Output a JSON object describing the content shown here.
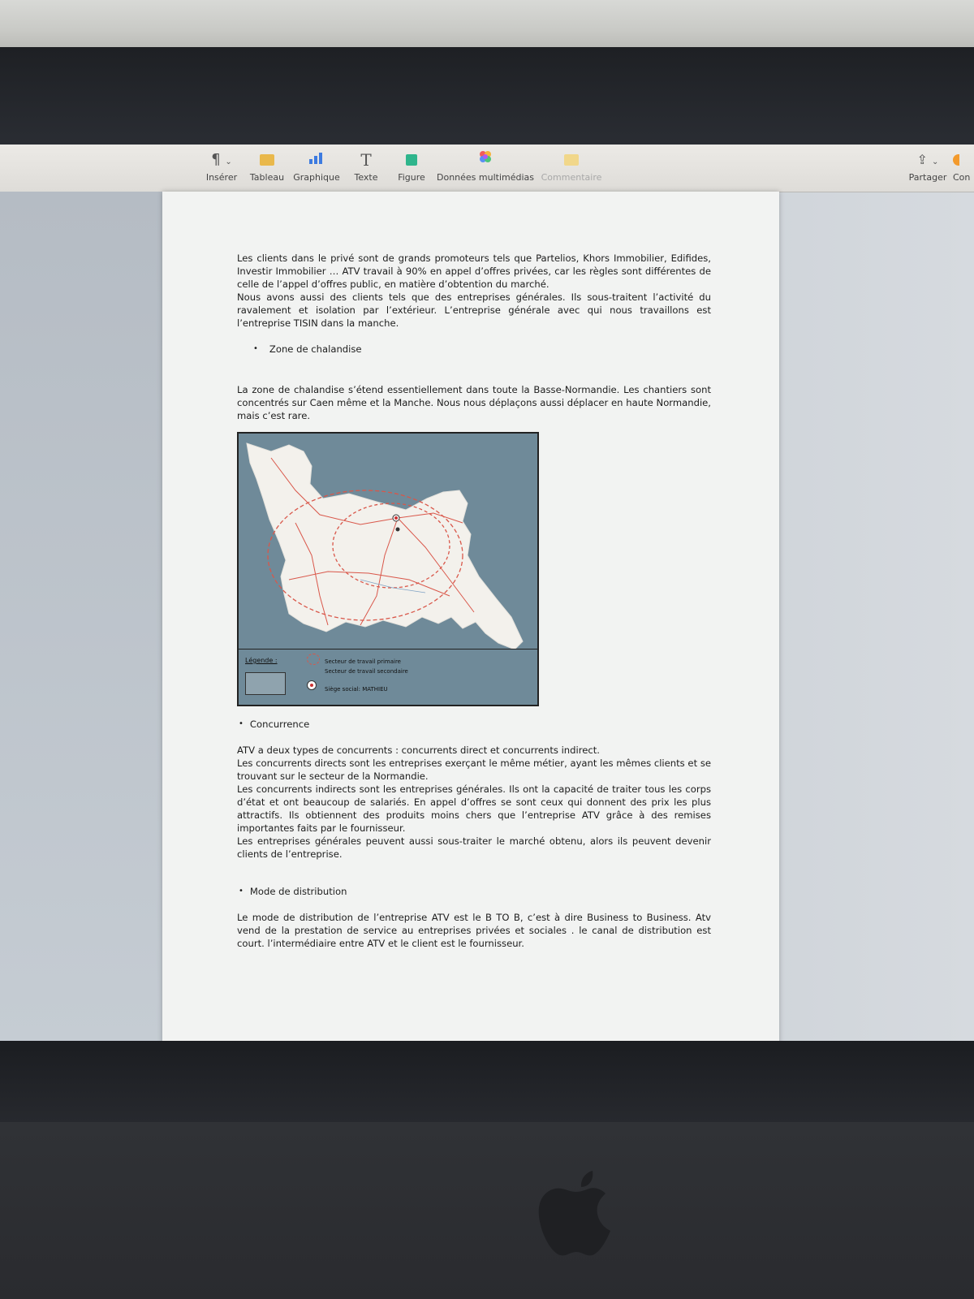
{
  "toolbar": {
    "items": [
      {
        "label": "Insérer",
        "icon": "paragraph-icon"
      },
      {
        "label": "Tableau",
        "icon": "table-icon"
      },
      {
        "label": "Graphique",
        "icon": "chart-icon"
      },
      {
        "label": "Texte",
        "icon": "text-icon"
      },
      {
        "label": "Figure",
        "icon": "shape-icon"
      },
      {
        "label": "Données multimédias",
        "icon": "media-icon"
      },
      {
        "label": "Commentaire",
        "icon": "comment-icon"
      }
    ],
    "share_label": "Partager",
    "cut_label": "Con"
  },
  "doc": {
    "para1": "Les clients dans le privé sont de grands promoteurs tels que Partelios, Khors Immobilier, Edifides, Investir Immobilier … ATV travail à 90% en appel d’offres privées, car les règles sont différentes de celle de l’appel d’offres public, en matière d’obtention du marché.",
    "para2": "Nous avons aussi des clients tels que des entreprises générales. Ils sous-traitent l’activité du ravalement et isolation par l’extérieur. L’entreprise générale avec qui nous travaillons est l’entreprise TISIN dans la manche.",
    "bullet1": "Zone de chalandise",
    "para3": "La zone de chalandise s’étend essentiellement dans toute la Basse-Normandie. Les chantiers sont concentrés sur Caen même et la Manche. Nous nous déplaçons aussi déplacer en haute Normandie, mais c’est rare.",
    "bullet2": "Concurrence",
    "para4": "ATV a deux types de concurrents : concurrents direct et concurrents indirect.",
    "para5": "Les concurrents directs sont les entreprises exerçant le même métier, ayant les mêmes clients et se trouvant sur le secteur de la Normandie.",
    "para6": "Les concurrents indirects sont les entreprises générales. Ils ont la capacité de traiter tous les corps d’état et ont beaucoup de salariés. En appel d’offres se sont ceux qui donnent des prix les plus attractifs. Ils obtiennent des  produits moins chers que l’entreprise ATV grâce à des remises importantes faits par le fournisseur.",
    "para7": "Les entreprises générales peuvent aussi sous-traiter le marché obtenu, alors ils peuvent  devenir clients de l’entreprise.",
    "bullet3": "Mode de distribution",
    "para8": "Le mode de distribution de l’entreprise ATV est le B TO B, c’est à dire Business to Business.  Atv vend de la prestation de service au entreprises privées et sociales . le canal de distribution est court. l’intermédiaire entre ATV et le client est le fournisseur."
  },
  "map": {
    "legend_title": "Légende :",
    "legend_primary": "Secteur de travail primaire",
    "legend_secondary": "Secteur de travail secondaire",
    "legend_hq": "Siège social: MATHIEU"
  },
  "colors": {
    "sea": "#6f8a99",
    "land": "#f3f1ec",
    "route": "#d9574a"
  }
}
